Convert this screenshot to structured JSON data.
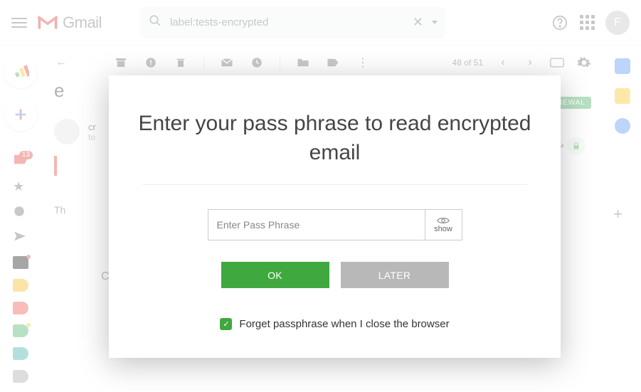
{
  "header": {
    "app_name": "Gmail",
    "search_value": "label:tests-encrypted",
    "avatar_initial": "F"
  },
  "toolbar": {
    "counter": "48 of 51"
  },
  "leftrail": {
    "inbox_badge": "13"
  },
  "main": {
    "subject_first_char": "e",
    "sender_line": "cr",
    "to_line": "to",
    "body_hint": "Th",
    "reply_hint": "C",
    "badge_text": "RENEWAL"
  },
  "modal": {
    "title": "Enter your pass phrase to read encrypted email",
    "placeholder": "Enter Pass Phrase",
    "show_label": "show",
    "ok_label": "OK",
    "later_label": "LATER",
    "forget_label": "Forget passphrase when I close the browser",
    "forget_checked": true
  }
}
